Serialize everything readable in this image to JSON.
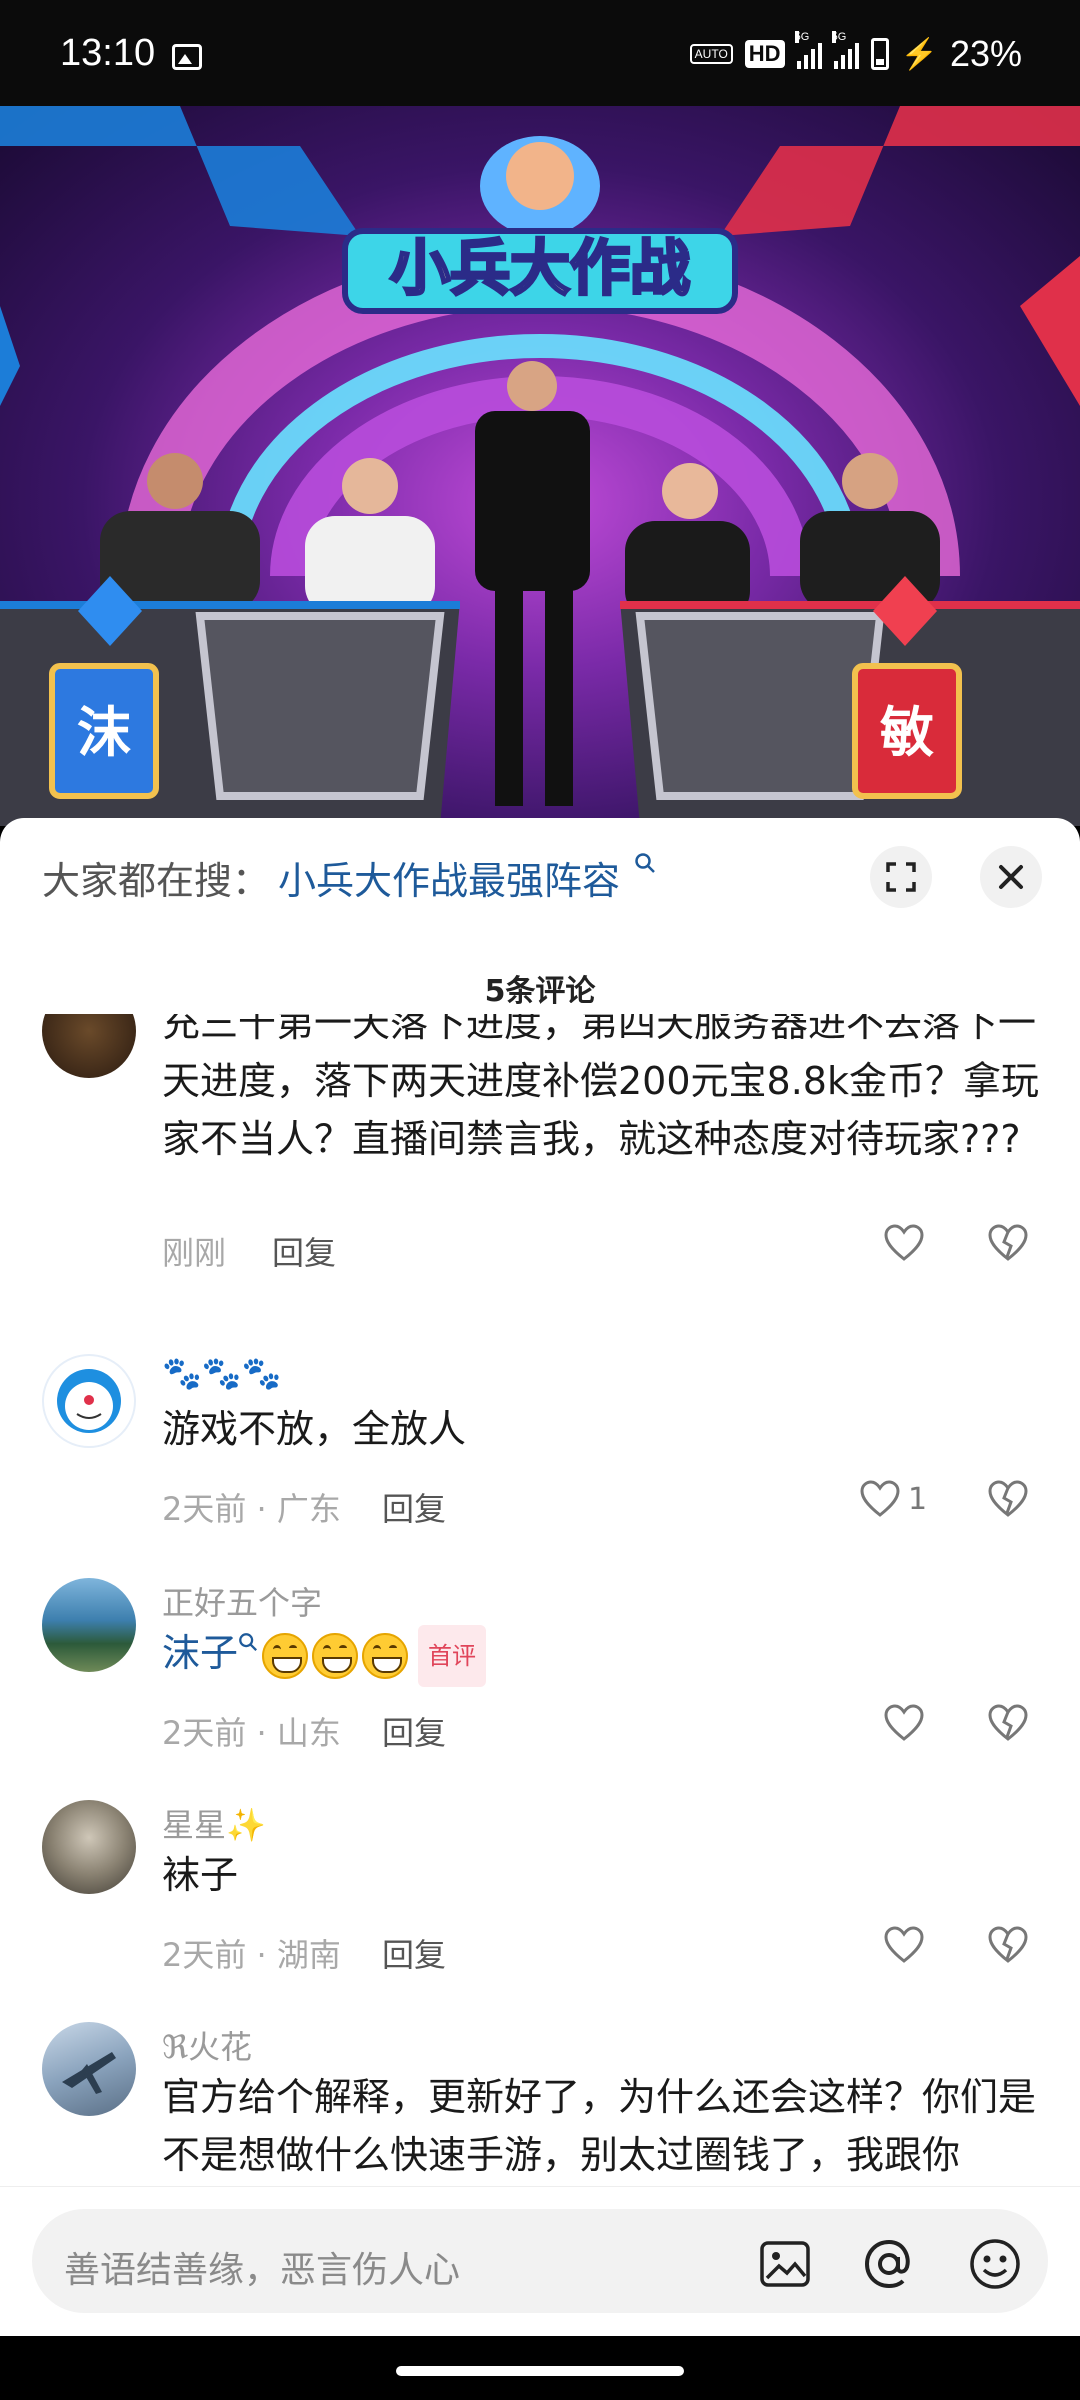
{
  "status_bar": {
    "time": "13:10",
    "gallery_icon": "image-icon",
    "auto_label": "AUTO",
    "hd_label": "HD",
    "net_label": "5G",
    "battery_pct": "23%"
  },
  "video": {
    "logo_text": "小兵大作战",
    "left_banner": "沫",
    "right_banner": "敏"
  },
  "search": {
    "prefix": "大家都在搜：",
    "query": "小兵大作战最强阵容",
    "expand_icon": "expand-icon",
    "close_icon": "close-icon"
  },
  "comment_count": "5条评论",
  "comments": [
    {
      "username": "",
      "text": "充三千第一天落下进度，第四天服务器进不去落下一天进度，落下两天进度补偿200元宝8.8k金币？拿玩家不当人？直播间禁言我，就这种态度对待玩家???",
      "time": "刚刚",
      "reply": "回复",
      "likes": ""
    },
    {
      "username": "🐾🐾🐾",
      "text": "游戏不放，全放人",
      "time": "2天前 · 广东",
      "reply": "回复",
      "likes": "1"
    },
    {
      "username": "正好五个字",
      "text": "沫子",
      "badge": "首评",
      "time": "2天前 · 山东",
      "reply": "回复",
      "likes": ""
    },
    {
      "username": "星星✨",
      "text": "袜子",
      "time": "2天前 · 湖南",
      "reply": "回复",
      "likes": ""
    },
    {
      "username": "ℜ火花",
      "text": "官方给个解释，更新好了，为什么还会这样？你们是不是想做什么快速手游，别太过圈钱了，我跟你",
      "time": "",
      "reply": "",
      "likes": ""
    }
  ],
  "input": {
    "placeholder": "善语结善缘，恶言伤人心",
    "image_icon": "image-icon",
    "mention_icon": "at-icon",
    "emoji_icon": "emoji-icon"
  },
  "colors": {
    "link": "#1e5a9a",
    "badge": "#e0455a",
    "meta": "#a8a8a8"
  }
}
